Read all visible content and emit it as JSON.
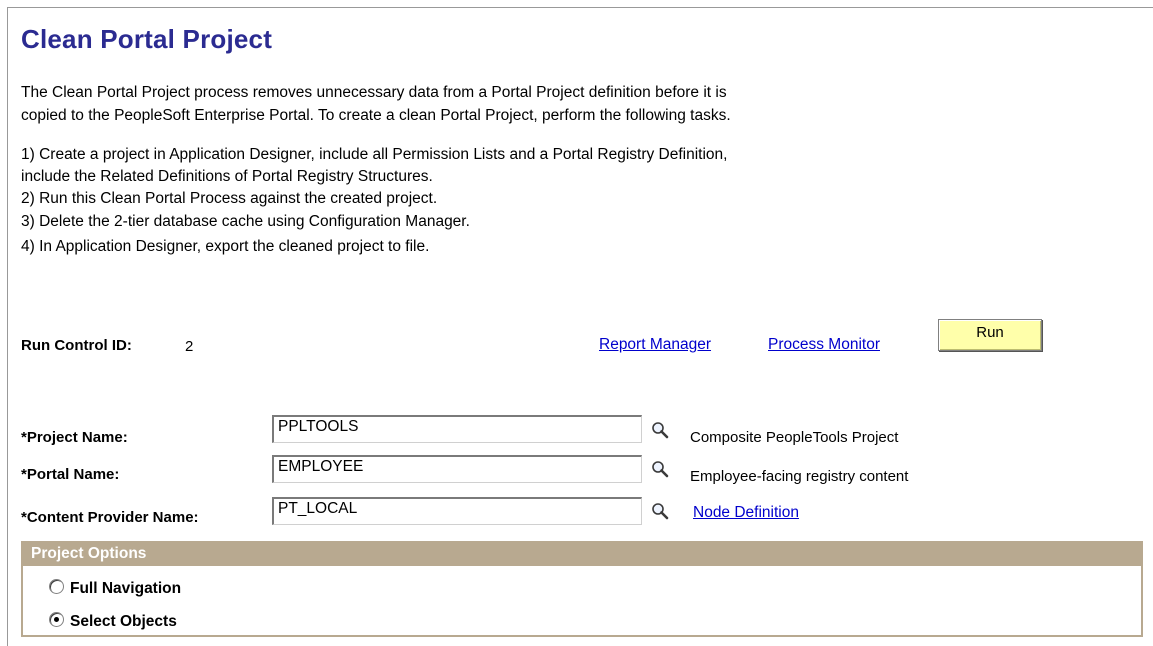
{
  "page": {
    "title": "Clean Portal Project",
    "intro_line1": "The Clean Portal Project process removes unnecessary data from a Portal Project definition before it is",
    "intro_line2": "copied to the PeopleSoft Enterprise Portal. To create a clean Portal Project, perform the following tasks.",
    "steps": [
      "1) Create a project in Application Designer, include all Permission Lists and a Portal Registry Definition,",
      "include the Related Definitions of Portal Registry Structures.",
      "2) Run this Clean Portal Process against the created project.",
      "3) Delete the 2-tier database cache using Configuration Manager.",
      "4) In Application Designer, export the cleaned project to file."
    ]
  },
  "run_control": {
    "label": "Run Control ID:",
    "value": "2",
    "report_manager": "Report Manager",
    "process_monitor": "Process Monitor",
    "run_label": "Run"
  },
  "fields": {
    "project_name": {
      "label": "*Project Name:",
      "value": "PPLTOOLS",
      "description": "Composite PeopleTools Project"
    },
    "portal_name": {
      "label": "*Portal Name:",
      "value": "EMPLOYEE",
      "description": "Employee-facing registry content"
    },
    "content_provider": {
      "label": "*Content Provider Name:",
      "value": "PT_LOCAL",
      "link": "Node Definition"
    }
  },
  "project_options": {
    "header": "Project Options",
    "options": [
      {
        "label": "Full Navigation",
        "selected": false
      },
      {
        "label": "Select Objects",
        "selected": true
      }
    ]
  },
  "icons": {
    "lookup": "magnifier-lookup-icon"
  },
  "colors": {
    "title": "#2b2b91",
    "link": "#0000cc",
    "run_button": "#ffffaa",
    "group_box": "#b8a990"
  }
}
